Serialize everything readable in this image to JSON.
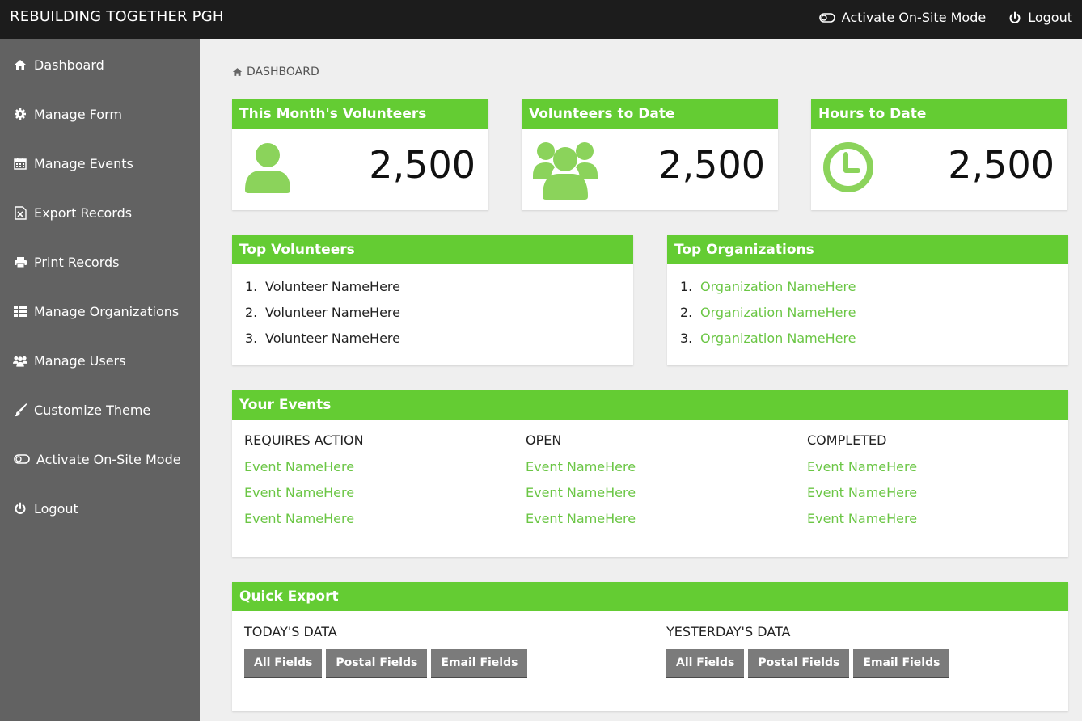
{
  "header": {
    "brand": "REBUILDING TOGETHER PGH",
    "onsite_label": "Activate On-Site Mode",
    "logout_label": "Logout"
  },
  "sidebar": {
    "items": [
      {
        "label": "Dashboard",
        "icon": "home-icon"
      },
      {
        "label": "Manage Form",
        "icon": "gear-icon"
      },
      {
        "label": "Manage Events",
        "icon": "calendar-icon"
      },
      {
        "label": "Export Records",
        "icon": "excel-file-icon"
      },
      {
        "label": "Print Records",
        "icon": "print-icon"
      },
      {
        "label": "Manage Organizations",
        "icon": "grid-icon"
      },
      {
        "label": "Manage Users",
        "icon": "users-icon"
      },
      {
        "label": "Customize Theme",
        "icon": "brush-icon"
      },
      {
        "label": "Activate On-Site Mode",
        "icon": "toggle-icon"
      },
      {
        "label": "Logout",
        "icon": "power-icon"
      }
    ]
  },
  "breadcrumb": "DASHBOARD",
  "stats": [
    {
      "title": "This Month's Volunteers",
      "value": "2,500",
      "icon": "user-icon"
    },
    {
      "title": "Volunteers to Date",
      "value": "2,500",
      "icon": "users-icon"
    },
    {
      "title": "Hours to Date",
      "value": "2,500",
      "icon": "clock-icon"
    }
  ],
  "top_volunteers": {
    "title": "Top Volunteers",
    "items": [
      "Volunteer NameHere",
      "Volunteer NameHere",
      "Volunteer NameHere"
    ]
  },
  "top_organizations": {
    "title": "Top Organizations",
    "items": [
      "Organization NameHere",
      "Organization NameHere",
      "Organization NameHere"
    ]
  },
  "events": {
    "title": "Your Events",
    "columns": [
      {
        "title": "REQUIRES ACTION",
        "items": [
          "Event NameHere",
          "Event NameHere",
          "Event NameHere"
        ]
      },
      {
        "title": "OPEN",
        "items": [
          "Event NameHere",
          "Event NameHere",
          "Event NameHere"
        ]
      },
      {
        "title": "COMPLETED",
        "items": [
          "Event NameHere",
          "Event NameHere",
          "Event NameHere"
        ]
      }
    ]
  },
  "quick_export": {
    "title": "Quick Export",
    "groups": [
      {
        "title": "TODAY'S DATA",
        "buttons": [
          "All Fields",
          "Postal Fields",
          "Email Fields"
        ]
      },
      {
        "title": "YESTERDAY'S DATA",
        "buttons": [
          "All Fields",
          "Postal Fields",
          "Email Fields"
        ]
      }
    ]
  },
  "colors": {
    "accent": "#64cc33",
    "link": "#6bc645",
    "sidebar": "#626262",
    "topbar": "#1c1c1c"
  }
}
